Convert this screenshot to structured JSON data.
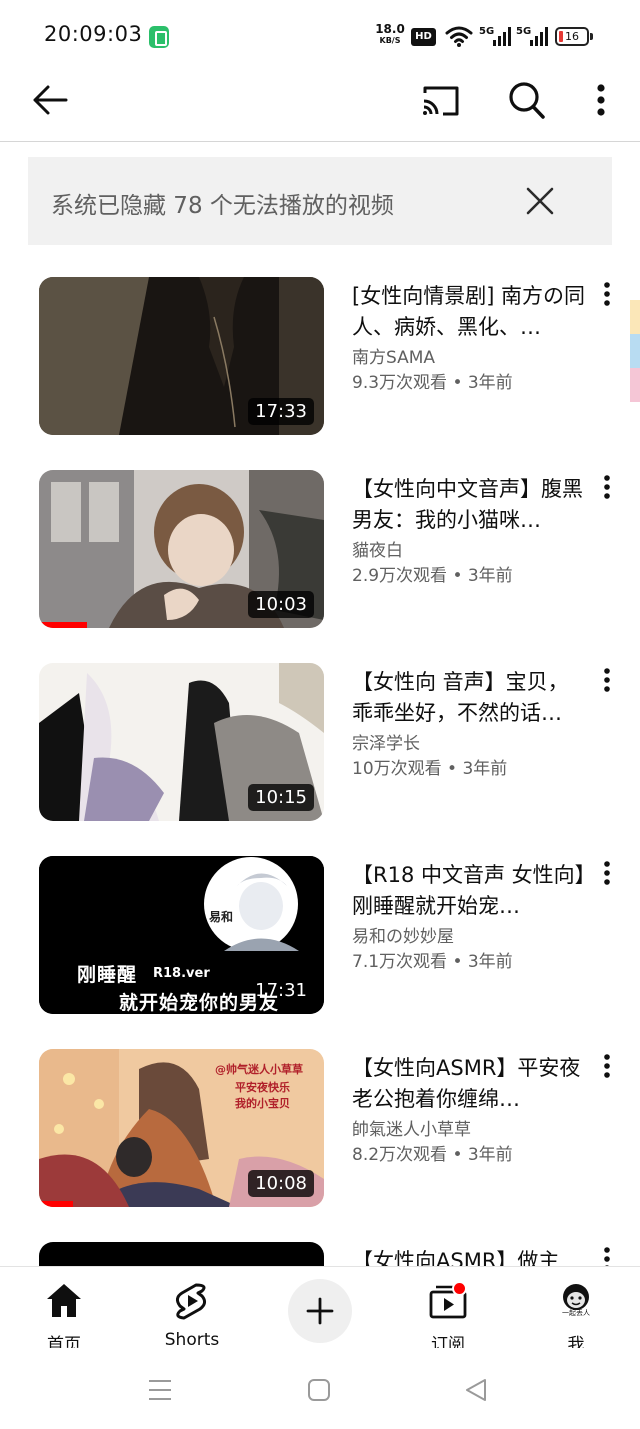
{
  "status_bar": {
    "time": "20:09:03",
    "net_speed_value": "18.0",
    "net_speed_unit": "KB/S",
    "hd_label": "HD",
    "battery_level": "16",
    "icons": [
      "battery-saver-icon",
      "wifi-icon",
      "5g-signal-icon",
      "5g-signal-icon",
      "battery-icon"
    ]
  },
  "app_bar": {
    "icons": [
      "back-arrow-icon",
      "cast-icon",
      "search-icon",
      "more-vert-icon"
    ]
  },
  "notice": {
    "text": "系统已隐藏 78 个无法播放的视频"
  },
  "videos": [
    {
      "title": "[女性向情景剧] 南方の同人、病娇、黑化、…",
      "channel": "南方SAMA",
      "meta": "9.3万次观看 • 3年前",
      "duration": "17:33",
      "watched_fraction": 0
    },
    {
      "title": "【女性向中文音声】腹黑男友：我的小猫咪…",
      "channel": "貓夜白",
      "meta": "2.9万次观看 • 3年前",
      "duration": "10:03",
      "watched_fraction": 0.17
    },
    {
      "title": "【女性向 音声】宝贝，乖乖坐好，不然的话…",
      "channel": "宗泽学长",
      "meta": "10万次观看 • 3年前",
      "duration": "10:15",
      "watched_fraction": 0
    },
    {
      "title": "【R18 中文音声 女性向】刚睡醒就开始宠…",
      "channel": "易和の妙妙屋",
      "meta": "7.1万次观看 • 3年前",
      "duration": "17:31",
      "watched_fraction": 0,
      "thumb_text": {
        "line1": "刚睡醒",
        "tag": "R18.ver",
        "line2": "就开始宠你的男友",
        "avatar_label": "易和"
      }
    },
    {
      "title": "【女性向ASMR】平安夜老公抱着你缠绵…",
      "channel": "帥氣迷人小草草",
      "meta": "8.2万次观看 • 3年前",
      "duration": "10:08",
      "watched_fraction": 0.12,
      "thumb_text": {
        "line1": "@帅气迷人小草草",
        "line2": "平安夜快乐",
        "line3": "我的小宝贝"
      }
    },
    {
      "title": "【女性向ASMR】做主",
      "channel": "",
      "meta": "",
      "duration": "",
      "watched_fraction": 0
    }
  ],
  "bottom_nav": {
    "items": [
      {
        "label": "首页",
        "icon": "home-icon"
      },
      {
        "label": "Shorts",
        "icon": "shorts-icon"
      },
      {
        "label": "",
        "icon": "create-plus-icon"
      },
      {
        "label": "订阅",
        "icon": "subscriptions-icon"
      },
      {
        "label": "我",
        "icon": "avatar-icon",
        "avatar_caption": "一起丢人"
      }
    ]
  },
  "system_nav": {
    "icons": [
      "recents-menu-icon",
      "home-square-icon",
      "back-triangle-icon"
    ]
  },
  "colors": {
    "accent_red": "#ff0000",
    "secondary_text": "#606060",
    "notice_background": "#f1f1f1"
  }
}
